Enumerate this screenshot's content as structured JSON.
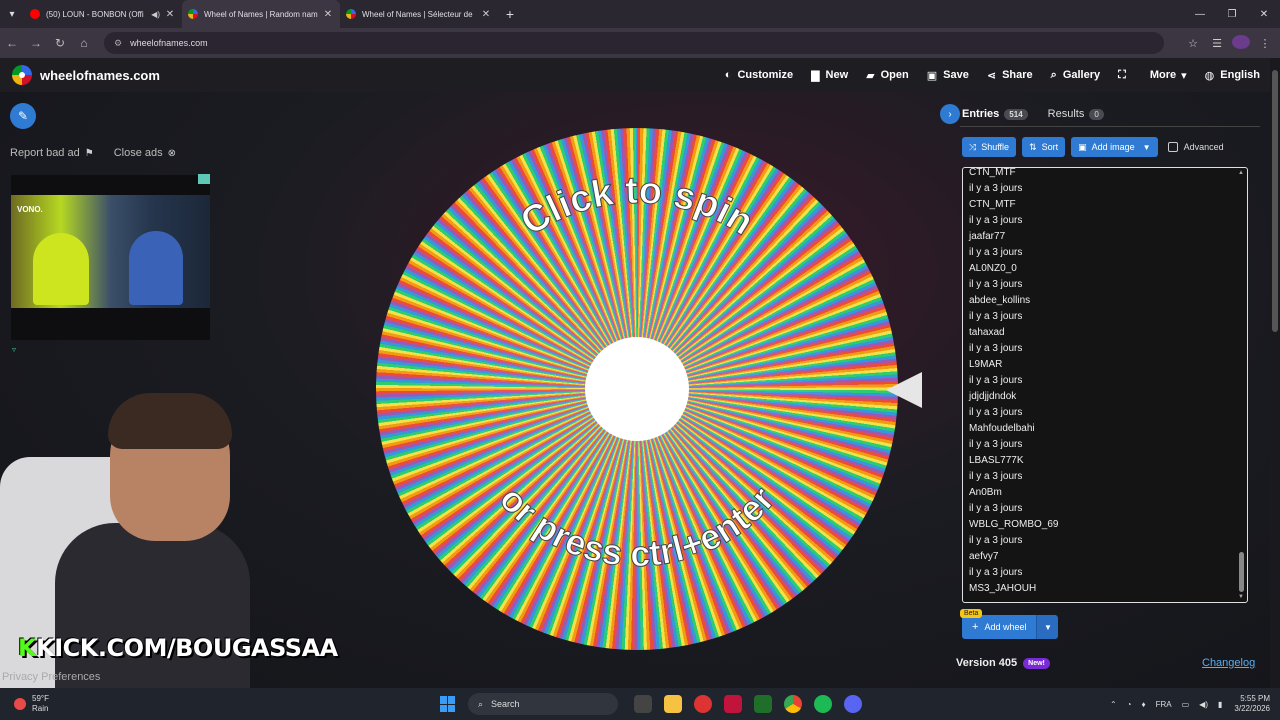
{
  "browser": {
    "tabs": [
      {
        "title": "(50) LOUN - BONBON (Offi",
        "favicon_color": "#ff0000",
        "active": false,
        "audio": true
      },
      {
        "title": "Wheel of Names | Random nam",
        "favicon_color": "#3369e8",
        "active": true,
        "audio": false
      },
      {
        "title": "Wheel of Names | Sélecteur de",
        "favicon_color": "#3369e8",
        "active": false,
        "audio": false
      }
    ],
    "url": "wheelofnames.com"
  },
  "header": {
    "site_name": "wheelofnames.com",
    "menu": [
      {
        "label": "Customize",
        "icon": "palette-icon",
        "glyph": "◐"
      },
      {
        "label": "New",
        "icon": "new-file-icon",
        "glyph": "▇"
      },
      {
        "label": "Open",
        "icon": "folder-icon",
        "glyph": "▰"
      },
      {
        "label": "Save",
        "icon": "save-icon",
        "glyph": "▣"
      },
      {
        "label": "Share",
        "icon": "share-icon",
        "glyph": "⋖"
      },
      {
        "label": "Gallery",
        "icon": "search-icon",
        "glyph": "⌕"
      },
      {
        "label": "",
        "icon": "fullscreen-icon",
        "glyph": "⛶"
      },
      {
        "label": "More",
        "icon": "caret-down-icon",
        "glyph": "▾"
      },
      {
        "label": "English",
        "icon": "globe-icon",
        "glyph": "◍"
      }
    ]
  },
  "left": {
    "report_ad": "Report bad ad",
    "close_ads": "Close ads",
    "ad_tag": "VONO."
  },
  "overlay": {
    "kick_prefix": "K",
    "kick_text": "KICK.COM/BOUGASSAA",
    "privacy": "Privacy Preferences"
  },
  "wheel": {
    "line1": "Click to spin",
    "line2": "or press ctrl+enter"
  },
  "panel": {
    "entries_tab": "Entries",
    "entries_count": "514",
    "results_tab": "Results",
    "results_count": "0",
    "shuffle": "Shuffle",
    "sort": "Sort",
    "add_image": "Add image",
    "advanced": "Advanced",
    "entries": [
      "CTN_MTF",
      "il y a 3 jours",
      "CTN_MTF",
      "il y a 3 jours",
      "jaafar77",
      "il y a 3 jours",
      "AL0NZ0_0",
      "il y a 3 jours",
      "abdee_kollins",
      "il y a 3 jours",
      "tahaxad",
      "il y a 3 jours",
      "L9MAR",
      "il y a 3 jours",
      "jdjdjjdndok",
      "il y a 3 jours",
      "Mahfoudelbahi",
      "il y a 3 jours",
      "LBASL777K",
      "il y a 3 jours",
      "An0Bm",
      "il y a 3 jours",
      "WBLG_ROMBO_69",
      "il y a 3 jours",
      "aefvy7",
      "il y a 3 jours",
      "MS3_JAHOUH"
    ],
    "beta": "Beta",
    "add_wheel": "Add wheel",
    "version": "Version 405",
    "new_badge": "New!",
    "changelog": "Changelog"
  },
  "taskbar": {
    "temp": "59°F",
    "weather": "Rain",
    "search": "Search",
    "lang": "FRA",
    "time": "5:55 PM",
    "date": "3/22/2026"
  }
}
